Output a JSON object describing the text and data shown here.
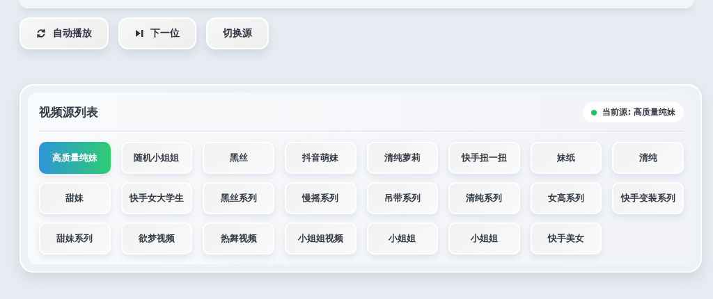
{
  "toolbar": [
    {
      "kind": "autoplay",
      "label": "自动播放"
    },
    {
      "kind": "next",
      "label": "下一位"
    },
    {
      "kind": "plain",
      "label": "切换源"
    }
  ],
  "source_list": {
    "title": "视频源列表",
    "current": {
      "label": "当前源: 高质量纯妹",
      "color": "#22c55e"
    },
    "items": [
      {
        "label": "高质量纯妹",
        "selected": true
      },
      {
        "label": "随机小姐姐",
        "selected": false
      },
      {
        "label": "黑丝",
        "selected": false
      },
      {
        "label": "抖音萌妹",
        "selected": false
      },
      {
        "label": "清纯萝莉",
        "selected": false
      },
      {
        "label": "快手扭一扭",
        "selected": false
      },
      {
        "label": "妹纸",
        "selected": false
      },
      {
        "label": "清纯",
        "selected": false
      },
      {
        "label": "甜妹",
        "selected": false
      },
      {
        "label": "快手女大学生",
        "selected": false
      },
      {
        "label": "黑丝系列",
        "selected": false
      },
      {
        "label": "慢摇系列",
        "selected": false
      },
      {
        "label": "吊带系列",
        "selected": false
      },
      {
        "label": "清纯系列",
        "selected": false
      },
      {
        "label": "女高系列",
        "selected": false
      },
      {
        "label": "快手变装系列",
        "selected": false
      },
      {
        "label": "甜妹系列",
        "selected": false
      },
      {
        "label": "欲梦视频",
        "selected": false
      },
      {
        "label": "热舞视频",
        "selected": false
      },
      {
        "label": "小姐姐视频",
        "selected": false
      },
      {
        "label": "小姐姐",
        "selected": false
      },
      {
        "label": "小姐姐",
        "selected": false
      },
      {
        "label": "快手美女",
        "selected": false
      }
    ]
  }
}
